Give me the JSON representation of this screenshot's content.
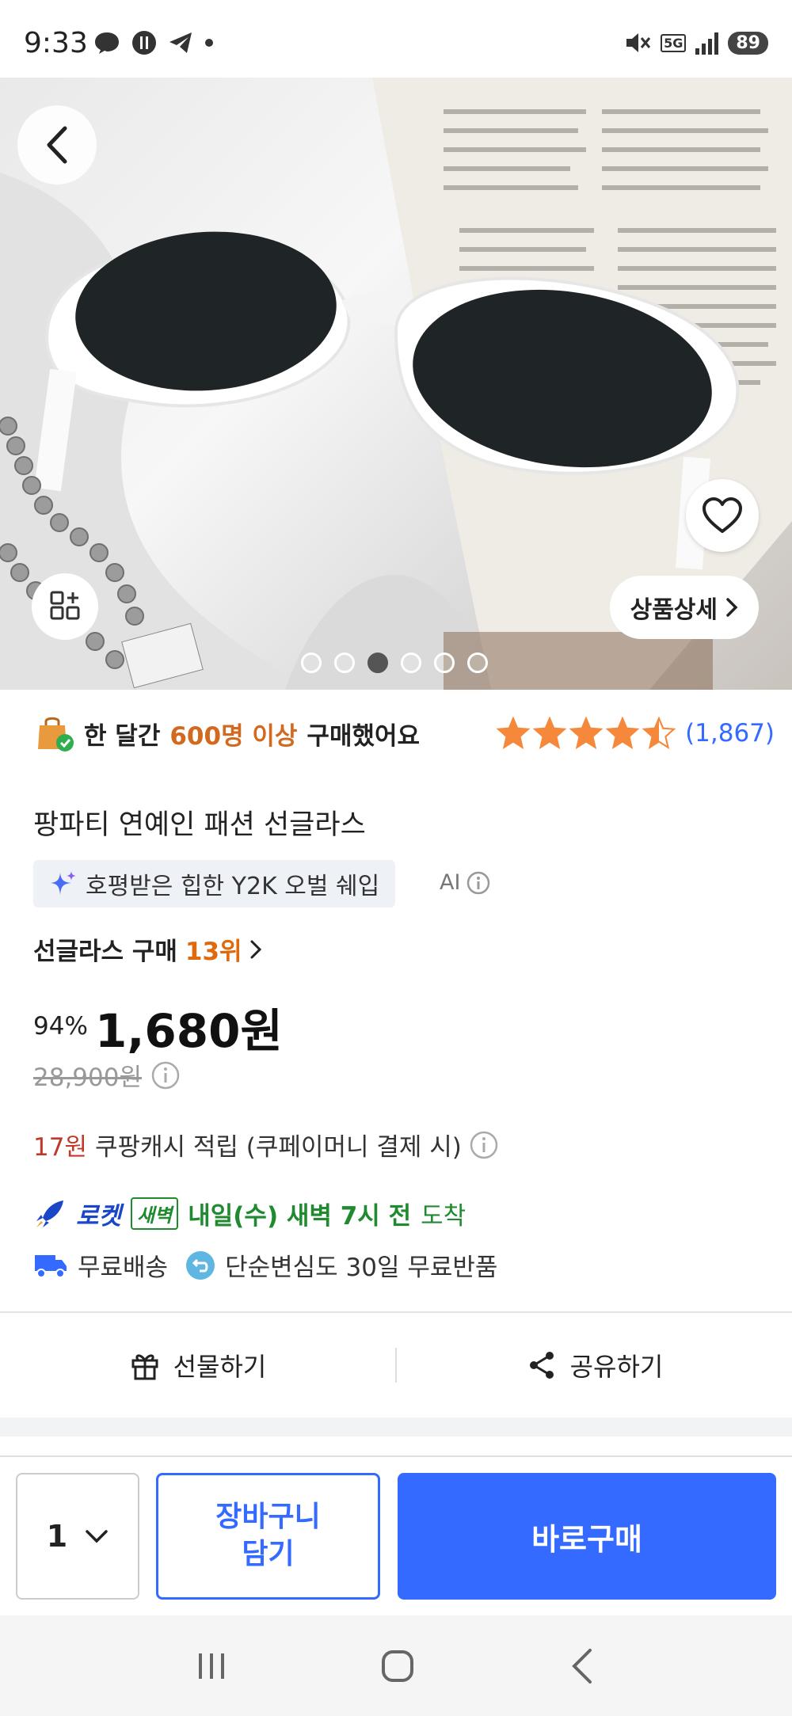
{
  "status_bar": {
    "time": "9:33",
    "network": "5G",
    "battery": "89"
  },
  "hero": {
    "detail_label": "상품상세",
    "dots_total": 6,
    "dots_active_index": 2
  },
  "product": {
    "purchase_prefix": "한 달간",
    "purchase_highlight": "600명 이상",
    "purchase_suffix": "구매했어요",
    "rating_stars": 4.5,
    "rating_count": "(1,867)",
    "title": "팡파티 연예인 패션 선글라스",
    "ai_summary": "호평받은 힙한 Y2K 오벌 쉐입",
    "ai_label": "AI",
    "rank_category": "선글라스 구매",
    "rank_number": "13위",
    "discount": "94%",
    "price": "1,680원",
    "original_price": "28,900원",
    "cash_amount": "17원",
    "cash_text": "쿠팡캐시 적립 (쿠페이머니 결제 시)",
    "rocket_word": "로켓",
    "rocket_badge": "새벽",
    "rocket_date": "내일(수) 새벽 7시 전",
    "rocket_arrive": "도착",
    "free_shipping": "무료배송",
    "free_return": "단순변심도 30일 무료반품"
  },
  "actions": {
    "gift": "선물하기",
    "share": "공유하기"
  },
  "bottom": {
    "quantity": "1",
    "cart_line1": "장바구니",
    "cart_line2": "담기",
    "buy": "바로구매"
  },
  "colors": {
    "accent": "#346aff",
    "star": "#f5883a",
    "highlight": "#d2691e",
    "rocket_green": "#1f8a2f"
  }
}
